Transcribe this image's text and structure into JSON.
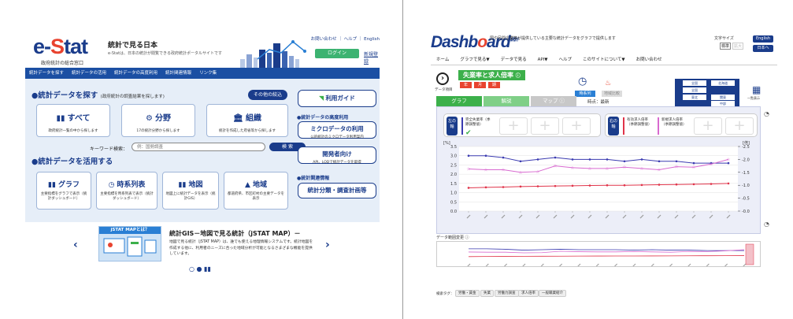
{
  "estat": {
    "logo": {
      "pre": "e-",
      "s": "S",
      "post": "tat",
      "sub": "政府統計の総合窓口"
    },
    "title": "統計で見る日本",
    "subtitle": "e-Statは、日本の統計が閲覧できる政府統計ポータルサイトです",
    "toplinks": "お問い合わせ ｜ ヘルプ ｜ English",
    "login": "ログイン",
    "register": "新規登録",
    "nav": [
      "統計データを探す",
      "統計データの活用",
      "統計データの高度利用",
      "統計関連情報",
      "リンク集"
    ],
    "search_section": {
      "title": "●統計データを探す",
      "note": "(政府統計の調査結果を探します)",
      "more": "その他の絞込"
    },
    "cards": [
      {
        "icon": "▮▮",
        "title": "すべて",
        "desc": "政府統計一覧の中から探します"
      },
      {
        "icon": "⚙",
        "title": "分野",
        "desc": "17の統計分野から探します"
      },
      {
        "icon": "🏛",
        "title": "組織",
        "desc": "統計を作成した府省等から探します"
      }
    ],
    "keyword": {
      "label": "キーワード検索：",
      "placeholder": "例：国勢調査",
      "button": "検 索"
    },
    "use_section": {
      "title": "●統計データを活用する"
    },
    "use_cards": [
      {
        "icon": "▮▮",
        "title": "グラフ",
        "desc": "主要指標をグラフで表示（統計ダッシュボード）"
      },
      {
        "icon": "◷",
        "title": "時系列表",
        "desc": "主要指標を時系列表で表示（統計ダッシュボード）"
      },
      {
        "icon": "▮▮",
        "title": "地図",
        "desc": "地図上に統計データを表示（統計GIS）"
      },
      {
        "icon": "▲",
        "title": "地域",
        "desc": "都道府県、市区町村の主要データを表示"
      }
    ],
    "guide": "利用ガイド",
    "adv_section": "●統計データの高度利用",
    "micro": {
      "title": "ミクロデータの利用",
      "sub": "公的統計のミクロデータ利用案内"
    },
    "dev": {
      "title": "開発者向け",
      "sub": "API、LODで統計データを取得"
    },
    "rel_section": "●統計関連情報",
    "classification": "統計分類・調査計画等",
    "banner": {
      "head": "jSTAT MAPとは？"
    },
    "gis_title": "統計GIS－地図で見る統計（jSTAT MAP）－",
    "gis_desc": "地図で見る統計（jSTAT MAP）は、誰でも使える地理情報システムです。統計地図を作成する他に、利用者のニーズに合った地域分析が可能となるさまざまな機能を提供しています。"
  },
  "dash": {
    "logo": {
      "pre": "Dashb",
      "o": "o",
      "post": "ard",
      "badge": "統計"
    },
    "tagline": "国や民間企業等が提供している主要な統計データをグラフで提供します",
    "font_size_label": "文字サイズ",
    "font_sizes": [
      "標準",
      "拡大"
    ],
    "lang": [
      "English",
      "日本へ"
    ],
    "nav": [
      "ホーム",
      "グラフで見る▼",
      "データで見る",
      "API▼",
      "ヘルプ",
      "このサイトについて▼",
      "お問い合わせ"
    ],
    "back_label": "データ項目",
    "indicator": "失業率と求人倍率",
    "periods": [
      "年",
      "月",
      "期"
    ],
    "ts_label": "時系列",
    "area_label": "地域比較",
    "point": "時点：最新",
    "regions": [
      "全国",
      "北海道",
      "全国",
      "東北",
      "関東",
      "中部"
    ],
    "grid_label": "一覧表示",
    "tabs": [
      "グラフ",
      "解説",
      "マップ"
    ],
    "left_axis": {
      "tag": "左の軸",
      "item": "完全失業率（季節調整値）"
    },
    "right_axis": {
      "tag": "右の軸",
      "items": [
        "有効求人倍率（季節調整値）",
        "新規求人倍率（季節調整値）"
      ]
    },
    "range_label": "データ範囲変更",
    "tag_label": "検索タグ：",
    "tags": [
      "労働・賃金",
      "失業",
      "労働力調査",
      "求人倍率",
      "一般職業紹介"
    ]
  },
  "chart_data": {
    "type": "line",
    "title": "",
    "xlabel": "",
    "ylabel_left": "[%]",
    "ylabel_right": "[倍]",
    "ylim_left": [
      0,
      3.5
    ],
    "ylim_right": [
      0,
      2.5
    ],
    "yticks_left": [
      "3.5",
      "3.0",
      "2.5",
      "2.0",
      "1.5",
      "1.0",
      "0.5",
      "0.0"
    ],
    "yticks_right": [
      "2.5",
      "2.0",
      "1.5",
      "1.0",
      "0.5",
      "0.0"
    ],
    "grid": true,
    "legend": "none",
    "colors": {
      "blue": "#3a3ab0",
      "pink": "#d86ad0",
      "red": "#e0344a"
    },
    "series": [
      {
        "axis": "left",
        "color": "blue",
        "values": [
          3.0,
          3.0,
          2.9,
          2.7,
          2.8,
          2.9,
          2.8,
          2.8,
          2.8,
          2.7,
          2.8,
          2.7,
          2.7,
          2.6,
          2.6,
          2.6
        ]
      },
      {
        "axis": "right",
        "color": "pink",
        "values": [
          1.63,
          1.6,
          1.6,
          1.5,
          1.53,
          1.75,
          1.68,
          1.65,
          1.65,
          1.7,
          1.65,
          1.6,
          1.72,
          1.7,
          1.82,
          2.0
        ]
      },
      {
        "axis": "right",
        "color": "red",
        "values": [
          0.9,
          0.92,
          0.93,
          0.95,
          0.96,
          0.97,
          0.98,
          0.99,
          1.0,
          1.0,
          1.01,
          1.02,
          1.03,
          1.04,
          1.05,
          1.07
        ]
      }
    ]
  }
}
